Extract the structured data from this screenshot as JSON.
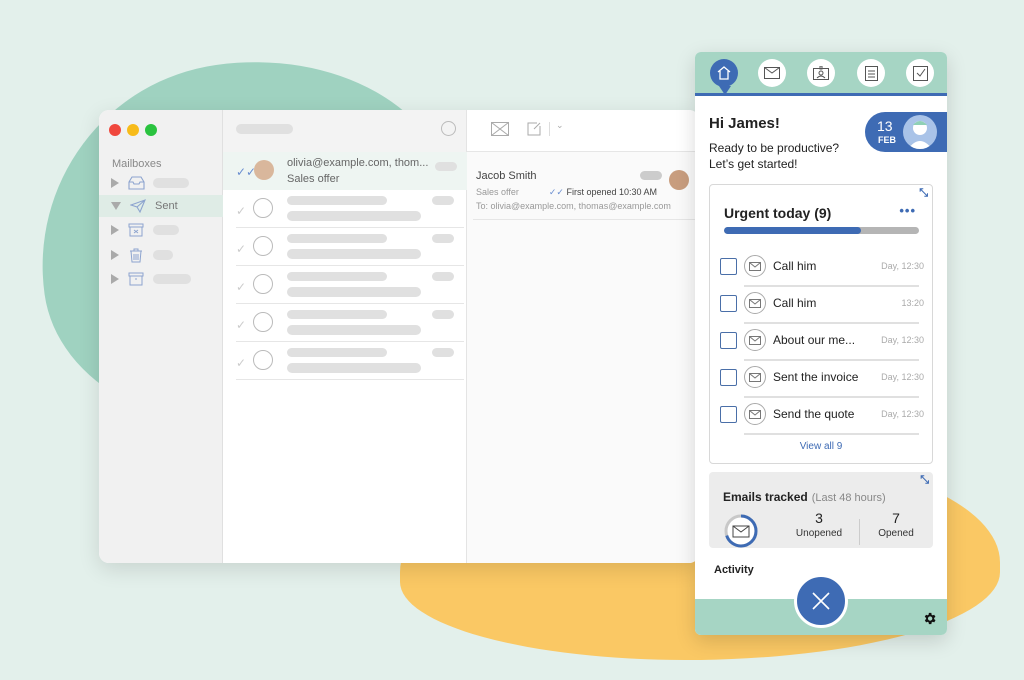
{
  "mail": {
    "sidebar": {
      "section_label": "Mailboxes",
      "items": [
        {
          "icon": "inbox-icon",
          "label": ""
        },
        {
          "icon": "send-icon",
          "label": "Sent"
        },
        {
          "icon": "junk-icon",
          "label": ""
        },
        {
          "icon": "trash-icon",
          "label": ""
        },
        {
          "icon": "archive-icon",
          "label": ""
        }
      ]
    },
    "list": {
      "first_message": {
        "recipients": "olivia@example.com, thom...",
        "subject": "Sales offer"
      },
      "placeholder_rows": 5
    },
    "reading": {
      "sender": "Jacob Smith",
      "subject": "Sales offer",
      "status": "First opened 10:30 AM",
      "to": "To: olivia@example.com, thomas@example.com"
    }
  },
  "panel": {
    "nav": [
      "home",
      "email",
      "contacts",
      "documents",
      "tasks"
    ],
    "greeting": "Hi James!",
    "subtitle_line1": "Ready to be productive?",
    "subtitle_line2": "Let’s get started!",
    "date": {
      "day": "13",
      "month": "FEB"
    },
    "urgent": {
      "title": "Urgent today (9)",
      "progress_percent": 70,
      "tasks": [
        {
          "label": "Call him",
          "time": "Day, 12:30"
        },
        {
          "label": "Call him",
          "time": "13:20"
        },
        {
          "label": "About our me...",
          "time": "Day, 12:30"
        },
        {
          "label": "Sent the invoice",
          "time": "Day, 12:30"
        },
        {
          "label": "Send the quote",
          "time": "Day, 12:30"
        }
      ],
      "view_all": "View all 9"
    },
    "tracked": {
      "title": "Emails tracked",
      "period": "(Last 48 hours)",
      "unopened_count": "3",
      "unopened_label": "Unopened",
      "opened_count": "7",
      "opened_label": "Opened",
      "opened_ratio": 0.7
    },
    "activity_label": "Activity"
  },
  "colors": {
    "accent": "#3e6bb4",
    "mint": "#a6d5c4"
  }
}
